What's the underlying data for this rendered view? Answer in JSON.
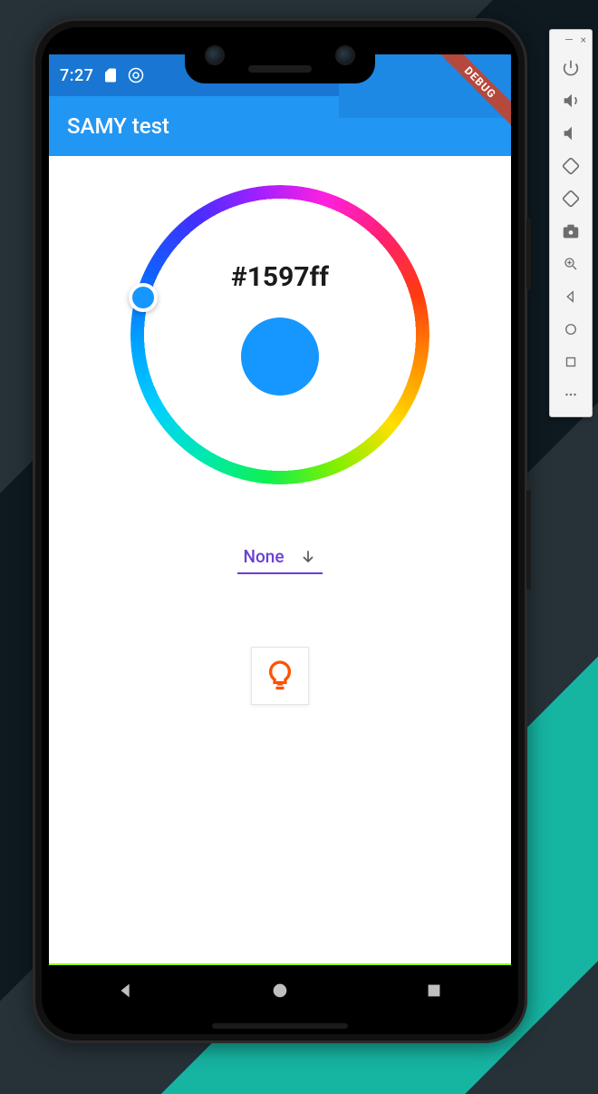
{
  "status": {
    "time": "7:27"
  },
  "app": {
    "title": "SAMY test"
  },
  "debug_banner": "DEBUG",
  "picker": {
    "hex": "#1597ff",
    "swatch_color": "#1597ff"
  },
  "dropdown": {
    "selected": "None"
  },
  "colors": {
    "accent": "#2196f3",
    "primary_dark": "#1976d2",
    "purple": "#6a3fd6",
    "bulb": "#fd5300"
  }
}
